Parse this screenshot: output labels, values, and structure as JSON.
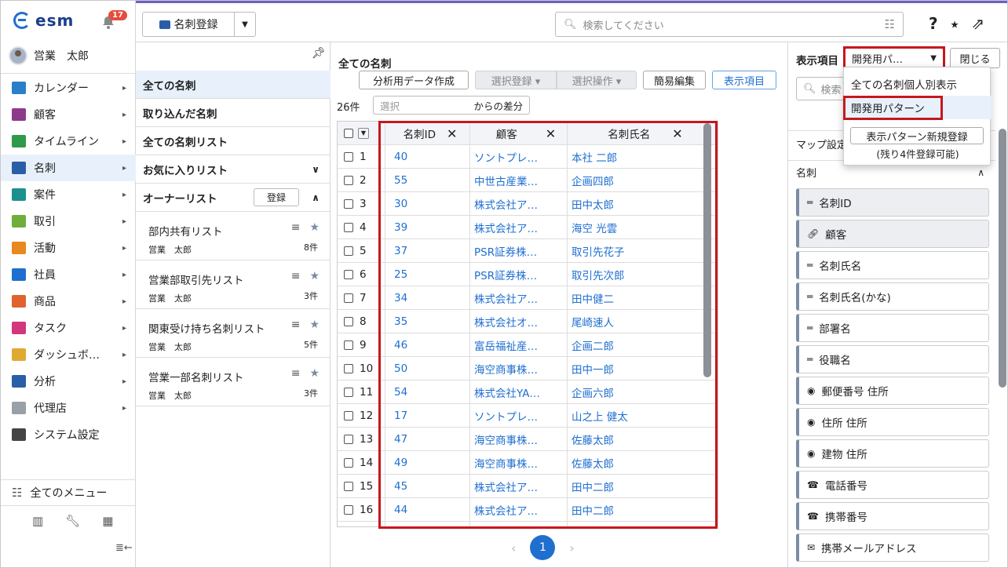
{
  "nav": {
    "logo": "esm",
    "notification_count": "17",
    "user_name": "営業　太郎",
    "items": [
      {
        "label": "カレンダー",
        "icon": "calendar-icon",
        "color": "#2a7fc9",
        "arrow": true
      },
      {
        "label": "顧客",
        "icon": "building-icon",
        "color": "#8e3a8a",
        "arrow": true
      },
      {
        "label": "タイムライン",
        "icon": "chat-icon",
        "color": "#2f9a4a",
        "arrow": true
      },
      {
        "label": "名刺",
        "icon": "business-card-icon",
        "color": "#2a5fa8",
        "arrow": true
      },
      {
        "label": "案件",
        "icon": "folder-icon",
        "color": "#1d8f8f",
        "arrow": true
      },
      {
        "label": "取引",
        "icon": "document-icon",
        "color": "#6fae3a",
        "arrow": true
      },
      {
        "label": "活動",
        "icon": "clipboard-icon",
        "color": "#e8891f",
        "arrow": true
      },
      {
        "label": "社員",
        "icon": "person-icon",
        "color": "#1f6fd0",
        "arrow": true
      },
      {
        "label": "商品",
        "icon": "box-icon",
        "color": "#e0622f",
        "arrow": true
      },
      {
        "label": "タスク",
        "icon": "checklist-icon",
        "color": "#d3367a",
        "arrow": true
      },
      {
        "label": "ダッシュボ…",
        "icon": "dashboard-icon",
        "color": "#e0a92f",
        "arrow": true
      },
      {
        "label": "分析",
        "icon": "chart-icon",
        "color": "#2a5fa8",
        "arrow": true
      },
      {
        "label": "代理店",
        "icon": "agency-icon",
        "color": "#9aa0a8",
        "arrow": true
      },
      {
        "label": "システム設定",
        "icon": "gear-icon",
        "color": "#444",
        "arrow": false
      }
    ],
    "all_menu": "全てのメニュー"
  },
  "topbar": {
    "register_label": "名刺登録",
    "search_placeholder": "検索してください"
  },
  "listpanel": {
    "items": [
      "全ての名刺",
      "取り込んだ名刺",
      "全ての名刺リスト"
    ],
    "favorites": "お気に入りリスト",
    "owner": "オーナーリスト",
    "owner_register": "登録",
    "shared": [
      {
        "name": "部内共有リスト",
        "owner": "営業　太郎",
        "count": "8件"
      },
      {
        "name": "営業部取引先リスト",
        "owner": "営業　太郎",
        "count": "3件"
      },
      {
        "name": "関東受け持ち名刺リスト",
        "owner": "営業　太郎",
        "count": "5件"
      },
      {
        "name": "営業一部名刺リスト",
        "owner": "営業　太郎",
        "count": "3件"
      }
    ]
  },
  "main": {
    "title": "全ての名刺",
    "btn_analysis": "分析用データ作成",
    "btn_select_register": "選択登録 ▾",
    "btn_select_op": "選択操作 ▾",
    "btn_quick_edit": "簡易編集",
    "btn_display_items": "表示項目",
    "count": "26件",
    "diff_placeholder": "選択",
    "diff_text": "からの差分",
    "columns": [
      "名刺ID",
      "顧客",
      "名刺氏名"
    ],
    "rows": [
      [
        "1",
        "40",
        "ソントプレ…",
        "本社 二郎"
      ],
      [
        "2",
        "55",
        "中世古産業…",
        "企画四郎"
      ],
      [
        "3",
        "30",
        "株式会社ア…",
        "田中太郎"
      ],
      [
        "4",
        "39",
        "株式会社ア…",
        "海空 光雲"
      ],
      [
        "5",
        "37",
        "PSR証券株…",
        "取引先花子"
      ],
      [
        "6",
        "25",
        "PSR証券株…",
        "取引先次郎"
      ],
      [
        "7",
        "34",
        "株式会社ア…",
        "田中健二"
      ],
      [
        "8",
        "35",
        "株式会社オ…",
        "尾崎速人"
      ],
      [
        "9",
        "46",
        "富岳福祉産…",
        "企画二郎"
      ],
      [
        "10",
        "50",
        "海空商事株…",
        "田中一郎"
      ],
      [
        "11",
        "54",
        "株式会社YA…",
        "企画六郎"
      ],
      [
        "12",
        "17",
        "ソントプレ…",
        "山之上 健太"
      ],
      [
        "13",
        "47",
        "海空商事株…",
        "佐藤太郎"
      ],
      [
        "14",
        "49",
        "海空商事株…",
        "佐藤太郎"
      ],
      [
        "15",
        "45",
        "株式会社ア…",
        "田中二郎"
      ],
      [
        "16",
        "44",
        "株式会社ア…",
        "田中二郎"
      ]
    ],
    "page": "1"
  },
  "rightpanel": {
    "title": "表示項目",
    "pattern_selected": "開発用パ…",
    "close": "閉じる",
    "search_placeholder": "検索",
    "map_settings": "マップ設定",
    "section": "名刺",
    "fields": [
      {
        "label": "名刺ID",
        "icon": "text-lines-icon",
        "gray": true
      },
      {
        "label": "顧客",
        "icon": "link-icon",
        "gray": true
      },
      {
        "label": "名刺氏名",
        "icon": "text-lines-icon",
        "gray": false
      },
      {
        "label": "名刺氏名(かな)",
        "icon": "text-lines-icon",
        "gray": false
      },
      {
        "label": "部署名",
        "icon": "text-lines-icon",
        "gray": false
      },
      {
        "label": "役職名",
        "icon": "text-lines-icon",
        "gray": false
      },
      {
        "label": "郵便番号 住所",
        "icon": "location-pin-icon",
        "gray": false
      },
      {
        "label": "住所 住所",
        "icon": "location-pin-icon",
        "gray": false
      },
      {
        "label": "建物 住所",
        "icon": "location-pin-icon",
        "gray": false
      },
      {
        "label": "電話番号",
        "icon": "phone-icon",
        "gray": false
      },
      {
        "label": "携帯番号",
        "icon": "phone-icon",
        "gray": false
      },
      {
        "label": "携帯メールアドレス",
        "icon": "mail-icon",
        "gray": false
      }
    ],
    "dropdown": {
      "option_all": "全ての名刺個人別表示",
      "option_dev": "開発用パターン",
      "new_pattern": "表示パターン新規登録",
      "remaining": "(残り4件登録可能)"
    }
  }
}
